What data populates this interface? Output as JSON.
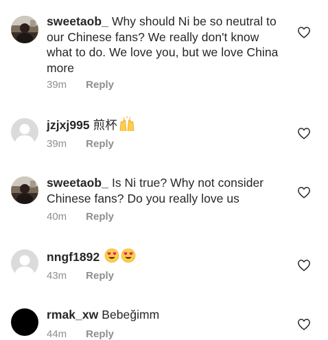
{
  "comments": [
    {
      "username": "sweetaob_",
      "text": "Why should Ni be so neutral to our Chinese fans? We really don't know what to do. We love you, but we love China more",
      "time": "39m",
      "reply_label": "Reply",
      "avatar": "photo-avatar",
      "like_icon": "heart-outline-icon"
    },
    {
      "username": "jzjxj995",
      "text": "煎杯",
      "emoji": "raising-hands-emoji",
      "time": "39m",
      "reply_label": "Reply",
      "avatar": "default-avatar",
      "like_icon": "heart-outline-icon"
    },
    {
      "username": "sweetaob_",
      "text": "Is Ni true? Why not consider Chinese fans? Do you really love us",
      "time": "40m",
      "reply_label": "Reply",
      "avatar": "photo-avatar",
      "like_icon": "heart-outline-icon"
    },
    {
      "username": "nngf1892",
      "text": "",
      "emoji": "heart-eyes-emoji x2",
      "time": "43m",
      "reply_label": "Reply",
      "avatar": "default-avatar",
      "like_icon": "heart-outline-icon"
    },
    {
      "username": "rmak_xw",
      "text": "Bebeğimm",
      "time": "44m",
      "reply_label": "Reply",
      "avatar": "black-avatar",
      "like_icon": "heart-outline-icon"
    }
  ],
  "colors": {
    "text": "#262626",
    "secondary": "#8e8e8e",
    "avatar_default_bg": "#dbdbdb",
    "heart_stroke": "#262626"
  }
}
